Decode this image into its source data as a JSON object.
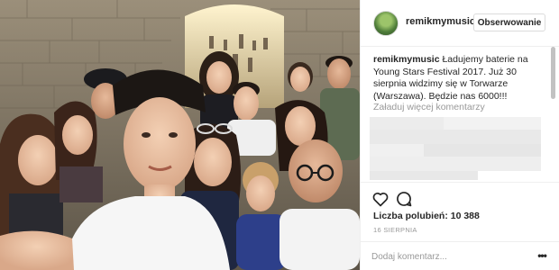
{
  "post": {
    "username": "remikmymusic",
    "follow_label": "Obserwowanie",
    "caption_user": "remikmymusic",
    "caption_text": "Ładujemy baterie na Young Stars Festival 2017. Już 30 sierpnia widzimy się w Torwarze (Warszawa). Będzie nas 6000!!!",
    "load_more_label": "Załaduj więcej komentarzy",
    "likes_label": "Liczba polubień: 10 388",
    "date_label": "16 SIERPNIA",
    "comment_placeholder": "Dodaj komentarz...",
    "more_glyph": "•••"
  },
  "icons": {
    "like": "heart-icon",
    "comment": "comment-icon",
    "more": "more-options-icon"
  },
  "colors": {
    "text": "#262626",
    "muted": "#999999",
    "border": "#efefef"
  }
}
